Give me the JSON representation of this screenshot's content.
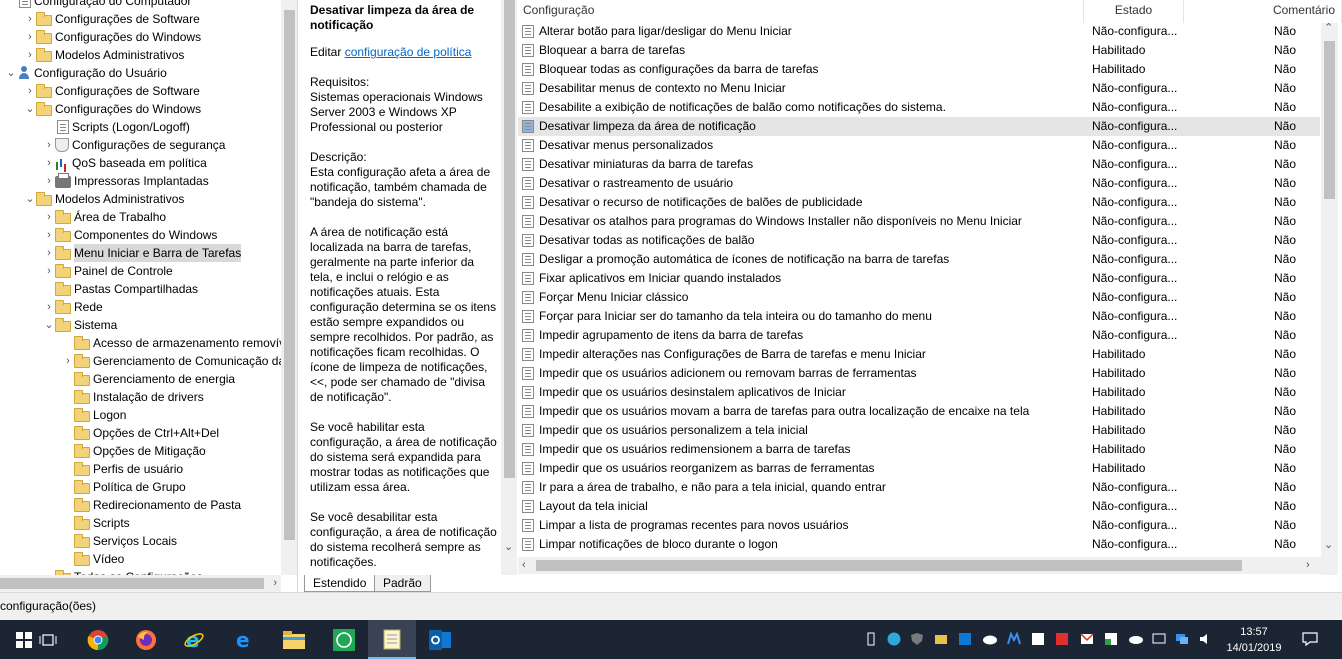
{
  "tree": {
    "items": [
      {
        "label": "Configuração do Computador",
        "icon": "computer-icon",
        "expander": ""
      },
      {
        "label": "Configurações de Software",
        "icon": "folder-icon",
        "expander": "›"
      },
      {
        "label": "Configurações do Windows",
        "icon": "folder-icon",
        "expander": "›"
      },
      {
        "label": "Modelos Administrativos",
        "icon": "folder-icon",
        "expander": "›"
      },
      {
        "label": "Configuração do Usuário",
        "icon": "user-icon",
        "expander": "⌄"
      },
      {
        "label": "Configurações de Software",
        "icon": "folder-icon",
        "expander": "›"
      },
      {
        "label": "Configurações do Windows",
        "icon": "folder-icon",
        "expander": "⌄"
      },
      {
        "label": "Scripts (Logon/Logoff)",
        "icon": "document-icon",
        "expander": ""
      },
      {
        "label": "Configurações de segurança",
        "icon": "shield-icon",
        "expander": "›"
      },
      {
        "label": "QoS baseada em política",
        "icon": "chart-icon",
        "expander": "›"
      },
      {
        "label": "Impressoras Implantadas",
        "icon": "printer-icon",
        "expander": "›"
      },
      {
        "label": "Modelos Administrativos",
        "icon": "folder-icon",
        "expander": "⌄"
      },
      {
        "label": "Área de Trabalho",
        "icon": "folder-icon",
        "expander": "›"
      },
      {
        "label": "Componentes do Windows",
        "icon": "folder-icon",
        "expander": "›"
      },
      {
        "label": "Menu Iniciar e Barra de Tarefas",
        "icon": "folder-icon",
        "expander": "›",
        "selected": true
      },
      {
        "label": "Painel de Controle",
        "icon": "folder-icon",
        "expander": "›"
      },
      {
        "label": "Pastas Compartilhadas",
        "icon": "folder-icon",
        "expander": ""
      },
      {
        "label": "Rede",
        "icon": "folder-icon",
        "expander": "›"
      },
      {
        "label": "Sistema",
        "icon": "folder-icon",
        "expander": "⌄"
      },
      {
        "label": "Acesso de armazenamento removível",
        "icon": "folder-icon",
        "expander": ""
      },
      {
        "label": "Gerenciamento de Comunicação da Ir",
        "icon": "folder-icon",
        "expander": "›"
      },
      {
        "label": "Gerenciamento de energia",
        "icon": "folder-icon",
        "expander": ""
      },
      {
        "label": "Instalação de drivers",
        "icon": "folder-icon",
        "expander": ""
      },
      {
        "label": "Logon",
        "icon": "folder-icon",
        "expander": ""
      },
      {
        "label": "Opções de Ctrl+Alt+Del",
        "icon": "folder-icon",
        "expander": ""
      },
      {
        "label": "Opções de Mitigação",
        "icon": "folder-icon",
        "expander": ""
      },
      {
        "label": "Perfis de usuário",
        "icon": "folder-icon",
        "expander": ""
      },
      {
        "label": "Política de Grupo",
        "icon": "folder-icon",
        "expander": ""
      },
      {
        "label": "Redirecionamento de Pasta",
        "icon": "folder-icon",
        "expander": ""
      },
      {
        "label": "Scripts",
        "icon": "folder-icon",
        "expander": ""
      },
      {
        "label": "Serviços Locais",
        "icon": "folder-icon",
        "expander": ""
      },
      {
        "label": "Vídeo",
        "icon": "folder-icon",
        "expander": ""
      },
      {
        "label": "Todas as Configurações",
        "icon": "folder-icon",
        "expander": ""
      }
    ]
  },
  "description": {
    "title": "Desativar limpeza da área de notificação",
    "edit_prefix": "Editar ",
    "edit_link": "configuração de política",
    "requirements": "Requisitos:\nSistemas operacionais Windows Server 2003 e Windows XP Professional ou posterior",
    "desc1": "Descrição:\nEsta configuração afeta a área de notificação, também chamada de \"bandeja do sistema\".",
    "desc2": "A área de notificação está localizada na barra de tarefas, geralmente na parte inferior da tela, e inclui o relógio e as notificações atuais. Esta configuração determina se os itens estão sempre expandidos ou sempre recolhidos. Por padrão, as notificações ficam recolhidas. O ícone de limpeza de notificações, <<, pode ser chamado de \"divisa de notificação\".",
    "desc3": "Se você habilitar esta configuração, a área de notificação do sistema será expandida para mostrar todas as notificações que utilizam essa área.",
    "desc4": "Se você desabilitar esta configuração, a área de notificação do sistema recolherá sempre as notificações."
  },
  "tabs": [
    {
      "label": "Estendido",
      "active": true
    },
    {
      "label": "Padrão",
      "active": false
    }
  ],
  "list": {
    "columns": {
      "name": "Configuração",
      "state": "Estado",
      "comment": "Comentário"
    },
    "rows": [
      {
        "name": "Alterar botão para ligar/desligar do Menu Iniciar",
        "state": "Não-configura...",
        "comment": "Não"
      },
      {
        "name": "Bloquear a barra de tarefas",
        "state": "Habilitado",
        "comment": "Não"
      },
      {
        "name": "Bloquear todas as configurações da barra de tarefas",
        "state": "Habilitado",
        "comment": "Não"
      },
      {
        "name": "Desabilitar menus de contexto no Menu Iniciar",
        "state": "Não-configura...",
        "comment": "Não"
      },
      {
        "name": "Desabilite a exibição de notificações de balão como notificações do sistema.",
        "state": "Não-configura...",
        "comment": "Não"
      },
      {
        "name": "Desativar limpeza da área de notificação",
        "state": "Não-configura...",
        "comment": "Não",
        "selected": true
      },
      {
        "name": "Desativar menus personalizados",
        "state": "Não-configura...",
        "comment": "Não"
      },
      {
        "name": "Desativar miniaturas da barra de tarefas",
        "state": "Não-configura...",
        "comment": "Não"
      },
      {
        "name": "Desativar o rastreamento de usuário",
        "state": "Não-configura...",
        "comment": "Não"
      },
      {
        "name": "Desativar o recurso de notificações de balões de publicidade",
        "state": "Não-configura...",
        "comment": "Não"
      },
      {
        "name": "Desativar os atalhos para programas do Windows Installer não disponíveis no Menu Iniciar",
        "state": "Não-configura...",
        "comment": "Não"
      },
      {
        "name": "Desativar todas as notificações de balão",
        "state": "Não-configura...",
        "comment": "Não"
      },
      {
        "name": "Desligar a promoção automática de ícones de notificação na barra de tarefas",
        "state": "Não-configura...",
        "comment": "Não"
      },
      {
        "name": "Fixar aplicativos em Iniciar quando instalados",
        "state": "Não-configura...",
        "comment": "Não"
      },
      {
        "name": "Forçar Menu Iniciar clássico",
        "state": "Não-configura...",
        "comment": "Não"
      },
      {
        "name": "Forçar para Iniciar ser do tamanho da tela inteira ou do tamanho do menu",
        "state": "Não-configura...",
        "comment": "Não"
      },
      {
        "name": "Impedir agrupamento de itens da barra de tarefas",
        "state": "Não-configura...",
        "comment": "Não"
      },
      {
        "name": "Impedir alterações nas Configurações de Barra de tarefas e menu Iniciar",
        "state": "Habilitado",
        "comment": "Não"
      },
      {
        "name": "Impedir que os usuários adicionem ou removam barras de ferramentas",
        "state": "Habilitado",
        "comment": "Não"
      },
      {
        "name": "Impedir que os usuários desinstalem aplicativos de Iniciar",
        "state": "Habilitado",
        "comment": "Não"
      },
      {
        "name": "Impedir que os usuários movam a barra de tarefas para outra localização de encaixe na tela",
        "state": "Habilitado",
        "comment": "Não"
      },
      {
        "name": "Impedir que os usuários personalizem a tela inicial",
        "state": "Habilitado",
        "comment": "Não"
      },
      {
        "name": "Impedir que os usuários redimensionem a barra de tarefas",
        "state": "Habilitado",
        "comment": "Não"
      },
      {
        "name": "Impedir que os usuários reorganizem as barras de ferramentas",
        "state": "Habilitado",
        "comment": "Não"
      },
      {
        "name": "Ir para a área de trabalho, e não para a tela inicial, quando entrar",
        "state": "Não-configura...",
        "comment": "Não"
      },
      {
        "name": "Layout da tela inicial",
        "state": "Não-configura...",
        "comment": "Não"
      },
      {
        "name": "Limpar a lista de programas recentes para novos usuários",
        "state": "Não-configura...",
        "comment": "Não"
      },
      {
        "name": "Limpar notificações de bloco durante o logon",
        "state": "Não-configura...",
        "comment": "Não"
      }
    ]
  },
  "status": {
    "text": "configuração(ões)"
  },
  "taskbar": {
    "time": "13:57",
    "date": "14/01/2019",
    "apps": [
      "windows-start-icon",
      "task-view-icon",
      "chrome-icon",
      "firefox-icon",
      "internet-explorer-icon",
      "edge-icon",
      "file-explorer-icon",
      "whatsapp-icon",
      "notepad-icon",
      "outlook-icon"
    ]
  }
}
